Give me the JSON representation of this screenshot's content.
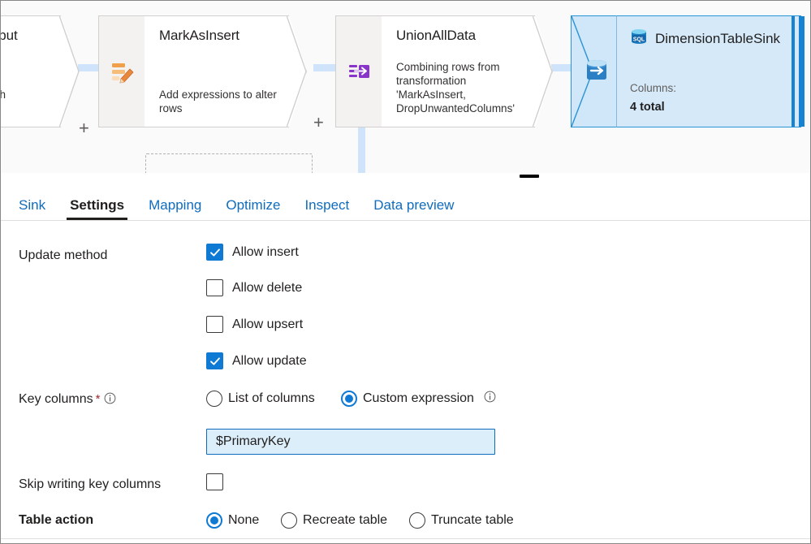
{
  "canvas": {
    "nodes": [
      {
        "id": "drop-unwanted-columns",
        "title": "edColsInput",
        "desc": "olumns to\nolsInput with\ntive,",
        "icon": "select-transformation-icon"
      },
      {
        "id": "mark-as-insert",
        "title": "MarkAsInsert",
        "desc": "Add expressions to alter rows",
        "icon": "alter-row-pencil-icon"
      },
      {
        "id": "union-all-data",
        "title": "UnionAllData",
        "desc": "Combining rows from transformation 'MarkAsInsert, DropUnwantedColumns'",
        "icon": "union-merge-icon"
      }
    ],
    "sink": {
      "id": "dimension-table-sink",
      "title": "DimensionTableSink",
      "badge_icon": "sql-database-icon",
      "node_icon": "sink-arrow-icon",
      "sub_label": "Columns:",
      "sub_value": "4 total"
    },
    "add_button_label": "+",
    "colors": {
      "wire": "#cfe4fa",
      "selected_border": "#2a93d6",
      "selected_fill": "#d5e9f9",
      "accent": "#1583d1",
      "canvas_bg": "#fafafa"
    }
  },
  "splitter": {
    "handle_name": "panel-resize-handle"
  },
  "tabs": [
    {
      "label": "Sink",
      "active": false
    },
    {
      "label": "Settings",
      "active": true
    },
    {
      "label": "Mapping",
      "active": false
    },
    {
      "label": "Optimize",
      "active": false
    },
    {
      "label": "Inspect",
      "active": false
    },
    {
      "label": "Data preview",
      "active": false
    }
  ],
  "settings": {
    "update_method": {
      "label": "Update method",
      "options": [
        {
          "label": "Allow insert",
          "checked": true
        },
        {
          "label": "Allow delete",
          "checked": false
        },
        {
          "label": "Allow upsert",
          "checked": false
        },
        {
          "label": "Allow update",
          "checked": true
        }
      ]
    },
    "key_columns": {
      "label": "Key columns",
      "required_marker": "*",
      "info_icon": "info-icon",
      "options": [
        {
          "label": "List of columns",
          "selected": false
        },
        {
          "label": "Custom expression",
          "selected": true
        }
      ],
      "expression_value": "$PrimaryKey",
      "expression_placeholder": ""
    },
    "skip_writing_key_columns": {
      "label": "Skip writing key columns",
      "checked": false
    },
    "table_action": {
      "label": "Table action",
      "options": [
        {
          "label": "None",
          "selected": true
        },
        {
          "label": "Recreate table",
          "selected": false
        },
        {
          "label": "Truncate table",
          "selected": false
        }
      ]
    }
  },
  "theme": {
    "link_blue": "#0f6cbd",
    "accent_blue": "#0f7ad4",
    "required_red": "#a4262c"
  }
}
